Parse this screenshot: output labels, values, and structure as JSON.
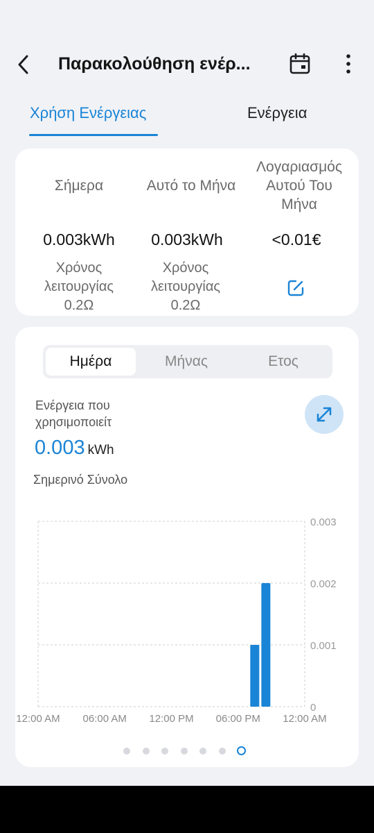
{
  "header": {
    "title": "Παρακολούθηση ενέρ..."
  },
  "tabs": [
    {
      "label": "Χρήση Ενέργειας",
      "active": true
    },
    {
      "label": "Ενέργεια",
      "active": false
    }
  ],
  "summary": {
    "today": {
      "label": "Σήμερα",
      "value": "0.003kWh",
      "runtime_label_1": "Χρόνος",
      "runtime_label_2": "λειτουργίας",
      "runtime_value": "0.2Ω"
    },
    "month": {
      "label": "Αυτό το Μήνα",
      "value": "0.003kWh",
      "runtime_label_1": "Χρόνος",
      "runtime_label_2": "λειτουργίας",
      "runtime_value": "0.2Ω"
    },
    "bill": {
      "label_1": "Λογαριασμός",
      "label_2": "Αυτού Του",
      "label_3": "Μήνα",
      "value": "<0.01€"
    }
  },
  "period": {
    "options": [
      "Ημέρα",
      "Μήνας",
      "Ετος"
    ],
    "selected": "Ημέρα"
  },
  "energy": {
    "label_1": "Ενέργεια που",
    "label_2": "χρησιμοποιείτ",
    "value": "0.003",
    "unit": "kWh",
    "total_label": "Σημερινό Σύνολο"
  },
  "chart_data": {
    "type": "bar",
    "xlabel": "",
    "ylabel": "",
    "ylim": [
      0,
      0.003
    ],
    "yticks": [
      "0.003",
      "0.002",
      "0.001",
      "0"
    ],
    "xticks": [
      "12:00 AM",
      "06:00 AM",
      "12:00 PM",
      "06:00 PM",
      "12:00 AM"
    ],
    "grid": true,
    "x": [
      "19:00",
      "20:00"
    ],
    "values": [
      0.001,
      0.002
    ],
    "color": "#1a84d6"
  },
  "pager": {
    "count": 7,
    "active_index": 6
  },
  "colors": {
    "accent": "#1a84d6",
    "background": "#f1f2f6",
    "card": "#ffffff"
  },
  "icons": {
    "back": "chevron-left-icon",
    "calendar": "calendar-icon",
    "more": "more-vertical-icon",
    "edit": "edit-icon",
    "expand": "expand-icon"
  }
}
